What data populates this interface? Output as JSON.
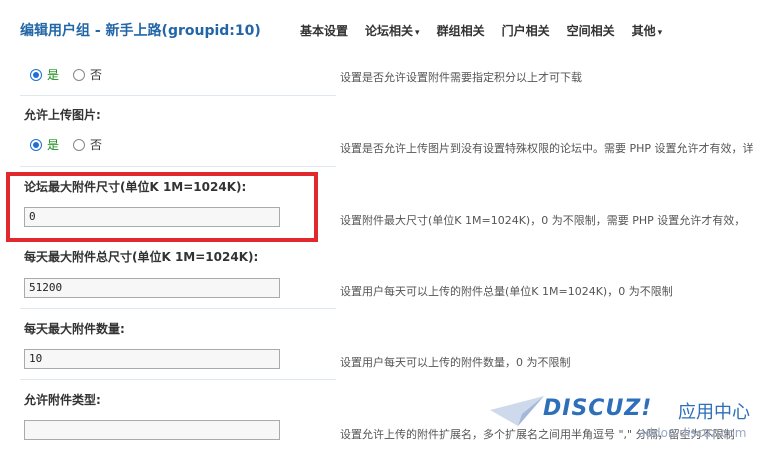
{
  "header": {
    "title": "编辑用户组 - 新手上路(groupid:10)",
    "nav": [
      {
        "label": "基本设置",
        "dropdown": false
      },
      {
        "label": "论坛相关",
        "dropdown": true
      },
      {
        "label": "群组相关",
        "dropdown": false
      },
      {
        "label": "门户相关",
        "dropdown": false
      },
      {
        "label": "空间相关",
        "dropdown": false
      },
      {
        "label": "其他",
        "dropdown": true
      }
    ],
    "caret": "▾"
  },
  "rows": {
    "download_points": {
      "yes": "是",
      "no": "否",
      "selected": "yes",
      "tip": "设置是否允许设置附件需要指定积分以上才可下载"
    },
    "upload_image": {
      "title": "允许上传图片:",
      "yes": "是",
      "no": "否",
      "selected": "yes",
      "tip": "设置是否允许上传图片到没有设置特殊权限的论坛中。需要 PHP 设置允许才有效，详"
    },
    "max_attach_size": {
      "title": "论坛最大附件尺寸(单位K 1M=1024K):",
      "value": "0",
      "tip": "设置附件最大尺寸(单位K 1M=1024K)，0 为不限制，需要 PHP 设置允许才有效，"
    },
    "max_daily_total": {
      "title": "每天最大附件总尺寸(单位K 1M=1024K):",
      "value": "51200",
      "tip": "设置用户每天可以上传的附件总量(单位K 1M=1024K)，0 为不限制"
    },
    "max_daily_count": {
      "title": "每天最大附件数量:",
      "value": "10",
      "tip": "设置用户每天可以上传的附件数量，0 为不限制"
    },
    "allowed_types": {
      "title": "允许附件类型:",
      "value": "",
      "tip": "设置允许上传的附件扩展名，多个扩展名之间用半角逗号 \",\" 分隔，留空为不限制"
    }
  },
  "watermark": {
    "brand": "DISCUZ!",
    "suffix": "应用中心",
    "url": "addon.discuz.com"
  },
  "colors": {
    "title_blue": "#2366a8",
    "highlight_red": "#e1282d",
    "radio_blue": "#1f6fd6",
    "yes_green": "#1a8a1a"
  }
}
